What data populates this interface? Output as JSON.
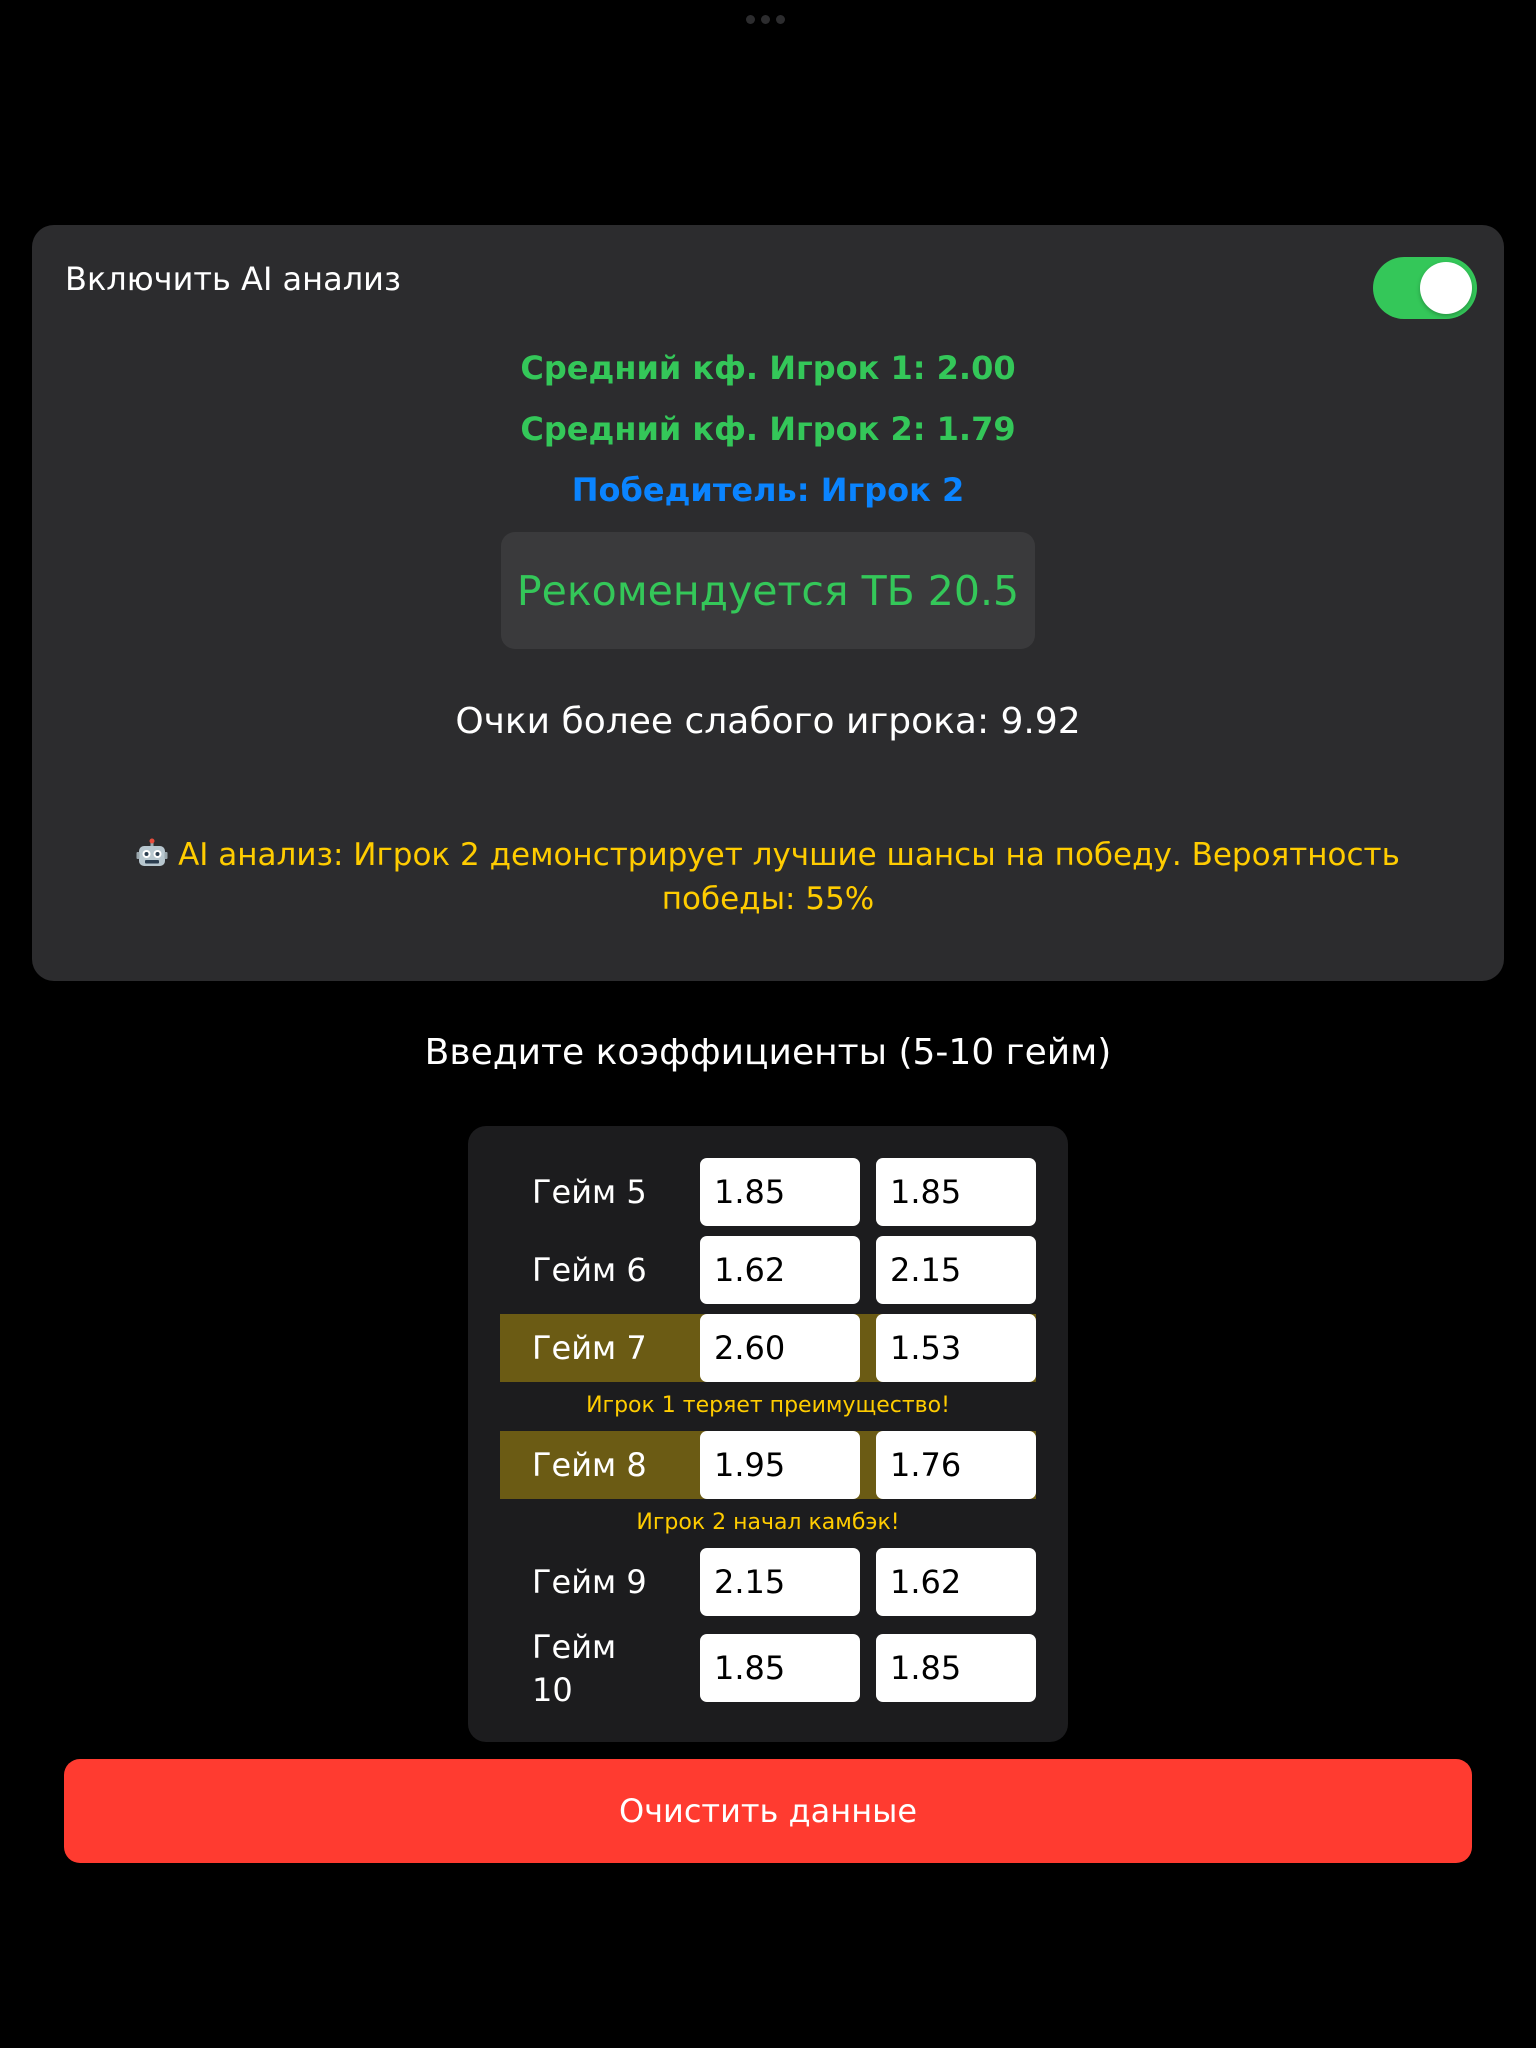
{
  "analysis": {
    "toggle_label": "Включить AI анализ",
    "toggle_on": true,
    "avg_player1": "Средний кф. Игрок 1: 2.00",
    "avg_player2": "Средний кф. Игрок 2: 1.79",
    "winner": "Победитель: Игрок 2",
    "recommendation": "Рекомендуется ТБ 20.5",
    "weak_player_points": "Очки более слабого игрока: 9.92",
    "ai_text": "AI анализ: Игрок 2 демонстрирует лучшие шансы на победу. Вероятность победы: 55%",
    "ai_icon": "robot-icon"
  },
  "input": {
    "title": "Введите коэффициенты (5-10 гейм)",
    "games": [
      {
        "label": "Гейм 5",
        "p1": "1.85",
        "p2": "1.85",
        "highlighted": false
      },
      {
        "label": "Гейм 6",
        "p1": "1.62",
        "p2": "2.15",
        "highlighted": false
      },
      {
        "label": "Гейм 7",
        "p1": "2.60",
        "p2": "1.53",
        "highlighted": true,
        "warning": "Игрок 1 теряет преимущество!"
      },
      {
        "label": "Гейм 8",
        "p1": "1.95",
        "p2": "1.76",
        "highlighted": true,
        "warning": "Игрок 2 начал камбэк!"
      },
      {
        "label": "Гейм 9",
        "p1": "2.15",
        "p2": "1.62",
        "highlighted": false
      },
      {
        "label": "Гейм 10",
        "p1": "1.85",
        "p2": "1.85",
        "highlighted": false
      }
    ]
  },
  "actions": {
    "clear_label": "Очистить данные"
  },
  "colors": {
    "background": "#000000",
    "card": "#2c2c2e",
    "accent_green": "#34c759",
    "accent_blue": "#0a84ff",
    "warning_yellow": "#ffcc00",
    "highlight_row": "#6b5b14",
    "danger_red": "#ff3b30"
  }
}
